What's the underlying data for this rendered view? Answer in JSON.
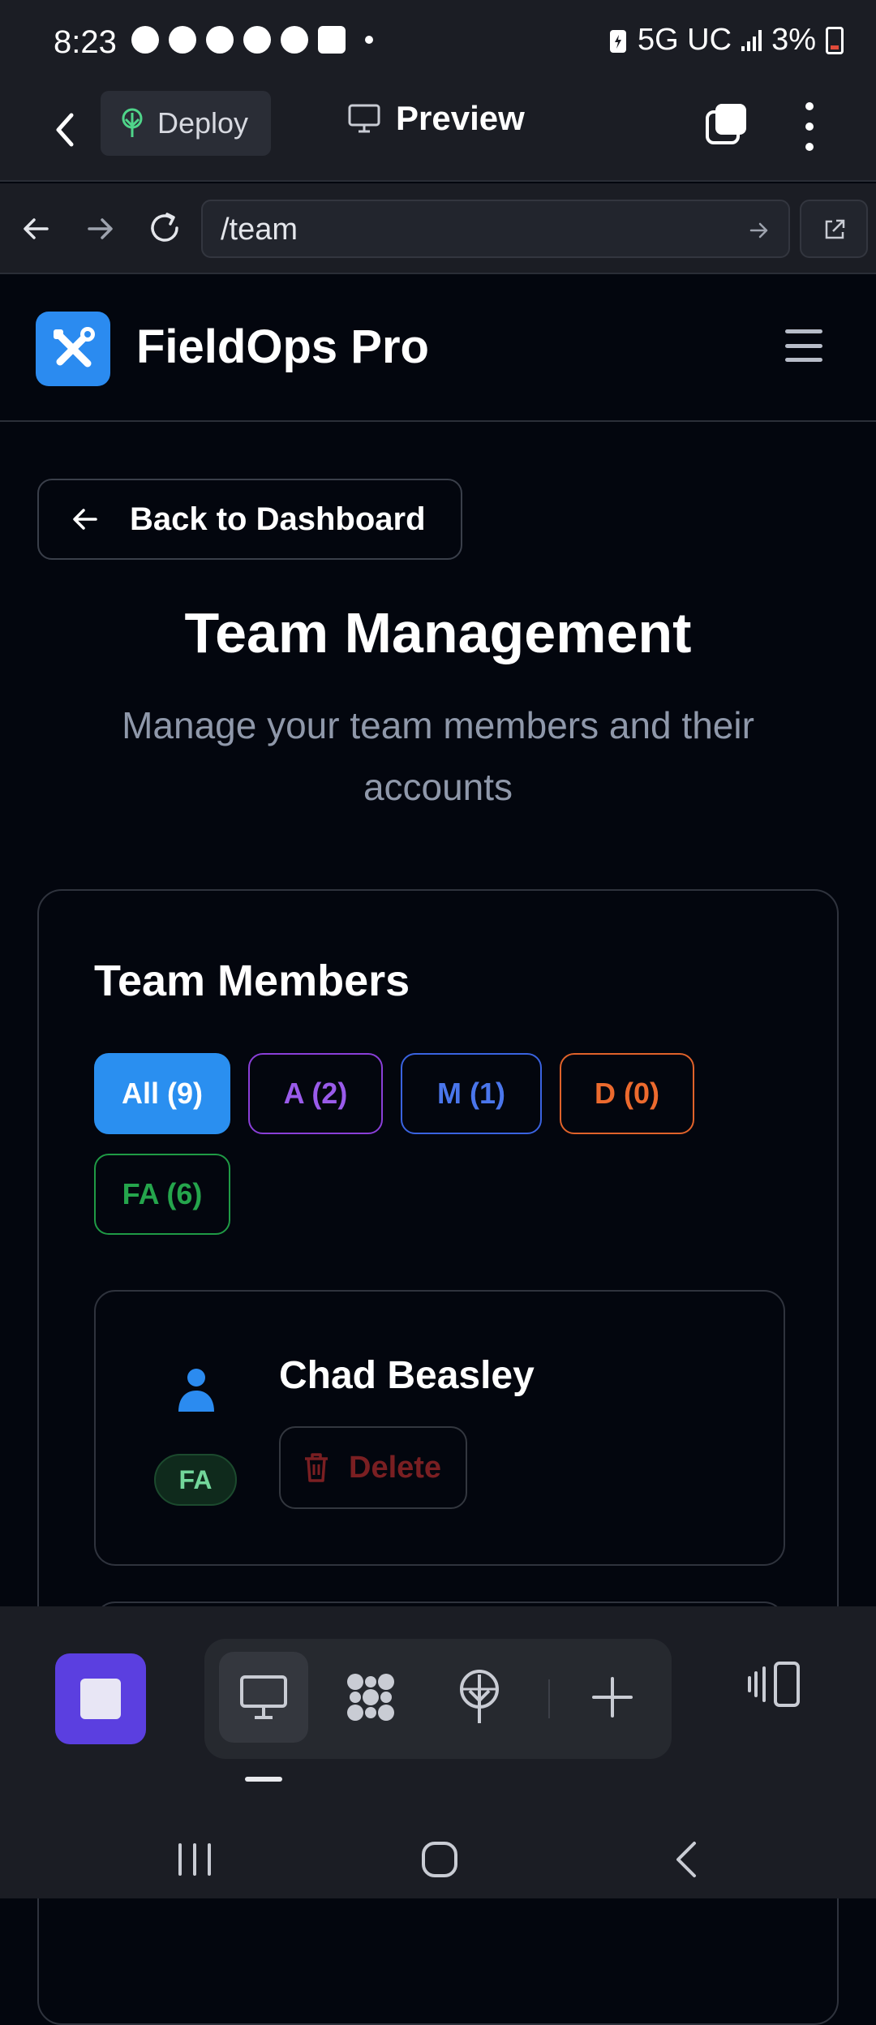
{
  "status_bar": {
    "time": "8:23",
    "network": "5G UC",
    "battery": "3%",
    "battery_alert_color": "#e04a3a"
  },
  "app_toolbar": {
    "deploy_label": "Deploy",
    "preview_label": "Preview"
  },
  "browser": {
    "url": "/team"
  },
  "site": {
    "brand": "FieldOps Pro",
    "brand_color": "#2b8bf0"
  },
  "page": {
    "back_label": "Back to Dashboard",
    "title": "Team Management",
    "subtitle": "Manage your team members and their accounts"
  },
  "members": {
    "title": "Team Members",
    "filters": [
      {
        "label": "All (9)",
        "color": "#2a8ff0",
        "selected": true
      },
      {
        "label": "A  (2)",
        "color": "#9a5bea",
        "selected": false
      },
      {
        "label": "M  (1)",
        "color": "#4a76ec",
        "selected": false
      },
      {
        "label": "D  (0)",
        "color": "#ec6a2e",
        "selected": false
      },
      {
        "label": "FA (6)",
        "color": "#25a54c",
        "selected": false
      }
    ],
    "list": [
      {
        "name": "Chad Beasley",
        "role": "FA",
        "delete_label": "Delete"
      }
    ]
  },
  "icons": {
    "toolbar": [
      "chevron-left-icon",
      "sprout-icon",
      "monitor-icon",
      "copy-icon",
      "more-vertical-icon"
    ],
    "nav": [
      "arrow-left-icon",
      "arrow-right-icon",
      "reload-icon",
      "arrow-right-small-icon",
      "external-link-icon"
    ],
    "bottom": [
      "stop-icon",
      "monitor-icon",
      "nodes-icon",
      "sprout-icon",
      "plus-icon",
      "layout-toggle-icon"
    ],
    "system": [
      "recents-icon",
      "home-icon",
      "back-icon"
    ]
  }
}
